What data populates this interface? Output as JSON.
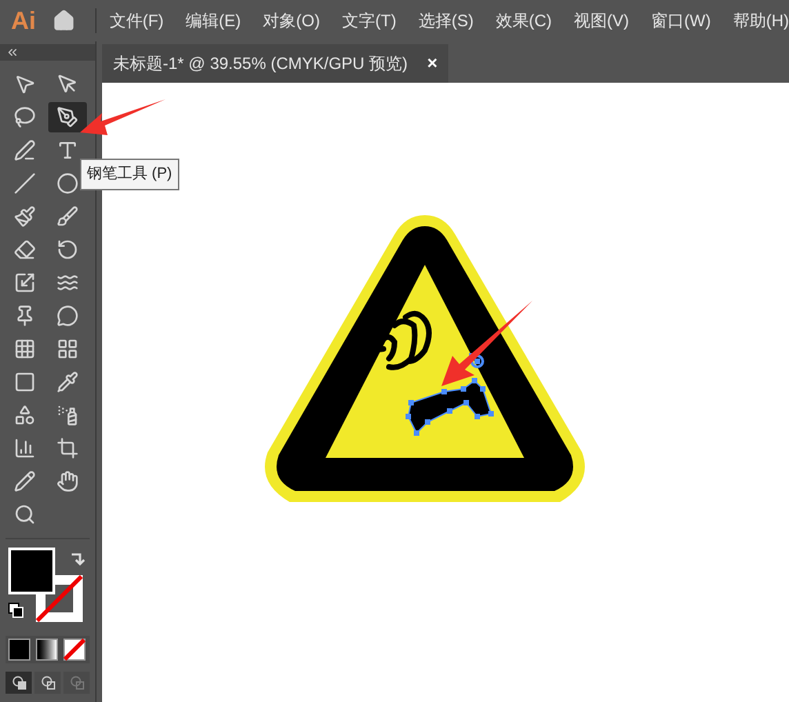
{
  "app_logo": "Ai",
  "menu": [
    "文件(F)",
    "编辑(E)",
    "对象(O)",
    "文字(T)",
    "选择(S)",
    "效果(C)",
    "视图(V)",
    "窗口(W)",
    "帮助(H)"
  ],
  "document_tab": {
    "title": "未标题-1* @ 39.55% (CMYK/GPU 预览)",
    "close": "×"
  },
  "tools": [
    {
      "selected": false
    },
    {
      "selected": false
    },
    {
      "selected": false
    },
    {
      "selected": true
    },
    {
      "selected": false
    },
    {
      "selected": false
    },
    {
      "selected": false
    },
    {
      "selected": false
    },
    {
      "selected": false
    },
    {
      "selected": false
    },
    {
      "selected": false
    },
    {
      "selected": false
    },
    {
      "selected": false
    },
    {
      "selected": false
    },
    {
      "selected": false
    },
    {
      "selected": false
    },
    {
      "selected": false
    },
    {
      "selected": false
    },
    {
      "selected": false
    },
    {
      "selected": false
    },
    {
      "selected": false
    },
    {
      "selected": false
    },
    {
      "selected": false
    },
    {
      "selected": false
    },
    {
      "selected": false
    },
    {
      "selected": false
    },
    {
      "selected": false
    }
  ],
  "tooltip": "钢笔工具 (P)",
  "draw_modes": [
    {
      "selected": true
    },
    {
      "selected": false
    },
    {
      "selected": false
    }
  ]
}
